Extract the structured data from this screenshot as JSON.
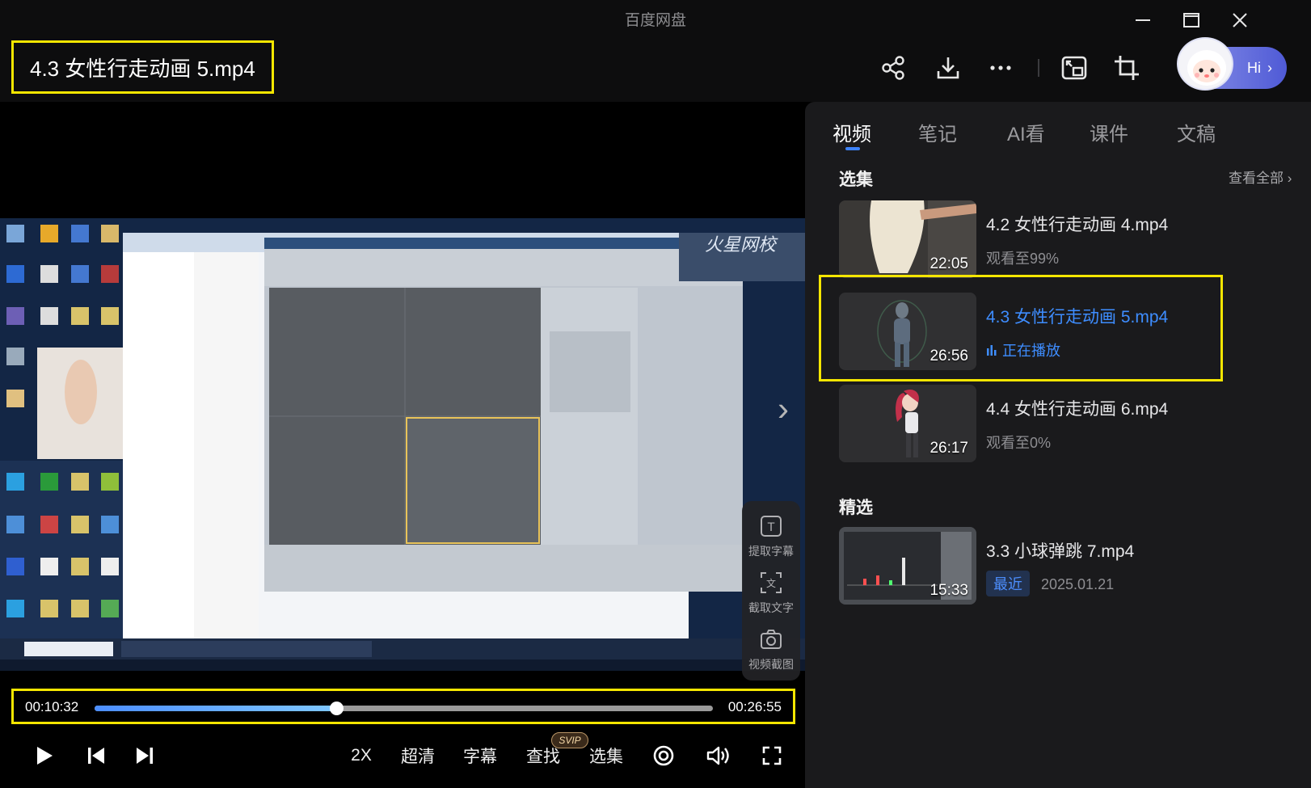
{
  "app": {
    "title": "百度网盘"
  },
  "window_controls": [
    "minimize-icon",
    "maximize-icon",
    "close-icon"
  ],
  "header": {
    "file_title": "4.3 女性行走动画 5.mp4",
    "tools": [
      "share-icon",
      "download-icon",
      "more-icon",
      "picture-in-picture-icon",
      "crop-icon"
    ],
    "assistant_greeting": "Hi"
  },
  "player": {
    "side_tools": {
      "extract_subtitles": "提取字幕",
      "capture_text": "截取文字",
      "video_screenshot": "视频截图"
    },
    "progress": {
      "current": "00:10:32",
      "total": "00:26:55",
      "fraction": 0.391
    },
    "controls": {
      "speed": "2X",
      "quality": "超清",
      "subtitles": "字幕",
      "search": "查找",
      "search_badge": "SVIP",
      "episodes": "选集"
    }
  },
  "panel": {
    "tabs": [
      "视频",
      "笔记",
      "AI看",
      "课件",
      "文稿"
    ],
    "active_tab": 0,
    "episodes_title": "选集",
    "view_all": "查看全部",
    "episodes": [
      {
        "title": "4.2 女性行走动画 4.mp4",
        "duration": "22:05",
        "status": "观看至99%",
        "playing": false
      },
      {
        "title": "4.3 女性行走动画 5.mp4",
        "duration": "26:56",
        "status": "正在播放",
        "playing": true
      },
      {
        "title": "4.4 女性行走动画 6.mp4",
        "duration": "26:17",
        "status": "观看至0%",
        "playing": false
      }
    ],
    "featured_title": "精选",
    "featured": {
      "title": "3.3 小球弹跳 7.mp4",
      "duration": "15:33",
      "badge": "最近",
      "date": "2025.01.21"
    }
  },
  "colors": {
    "accent": "#3e8dff",
    "highlight": "#f5e600",
    "panel_bg": "#1a1a1c"
  }
}
